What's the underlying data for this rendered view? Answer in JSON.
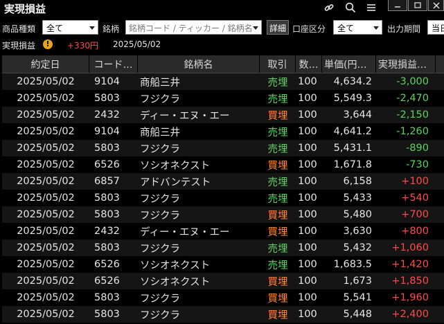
{
  "window": {
    "title": "実現損益"
  },
  "filters": {
    "product_type_label": "商品種類",
    "product_type_value": "全て",
    "issue_label": "銘柄",
    "issue_placeholder": "銘柄コード / ティッカー / 銘柄名",
    "detail_button": "詳細",
    "account_label": "口座区分",
    "account_value": "全て",
    "period_label": "出力期間",
    "period_value": "当日"
  },
  "summary": {
    "label": "実現損益",
    "warn_symbol": "!",
    "value": "+330円",
    "date": "2025/05/02"
  },
  "table": {
    "headers": [
      "約定日",
      "コード…",
      "銘柄名",
      "取引",
      "数…",
      "単価(円…",
      "実現損益…"
    ],
    "rows": [
      {
        "date": "2025/05/02",
        "code": "9104",
        "name": "商船三井",
        "side": "売埋",
        "qty": "100",
        "price": "4,634.2",
        "pl": "-3,000"
      },
      {
        "date": "2025/05/02",
        "code": "5803",
        "name": "フジクラ",
        "side": "売埋",
        "qty": "100",
        "price": "5,549.3",
        "pl": "-2,470"
      },
      {
        "date": "2025/05/02",
        "code": "2432",
        "name": "ディー・エヌ・エー",
        "side": "買埋",
        "qty": "100",
        "price": "3,644",
        "pl": "-2,150"
      },
      {
        "date": "2025/05/02",
        "code": "9104",
        "name": "商船三井",
        "side": "売埋",
        "qty": "100",
        "price": "4,641.2",
        "pl": "-1,260"
      },
      {
        "date": "2025/05/02",
        "code": "5803",
        "name": "フジクラ",
        "side": "売埋",
        "qty": "100",
        "price": "5,431.1",
        "pl": "-890"
      },
      {
        "date": "2025/05/02",
        "code": "6526",
        "name": "ソシオネクスト",
        "side": "買埋",
        "qty": "100",
        "price": "1,671.8",
        "pl": "-730"
      },
      {
        "date": "2025/05/02",
        "code": "6857",
        "name": "アドバンテスト",
        "side": "売埋",
        "qty": "100",
        "price": "6,158",
        "pl": "+100"
      },
      {
        "date": "2025/05/02",
        "code": "5803",
        "name": "フジクラ",
        "side": "売埋",
        "qty": "100",
        "price": "5,433",
        "pl": "+540"
      },
      {
        "date": "2025/05/02",
        "code": "5803",
        "name": "フジクラ",
        "side": "買埋",
        "qty": "100",
        "price": "5,480",
        "pl": "+700"
      },
      {
        "date": "2025/05/02",
        "code": "2432",
        "name": "ディー・エヌ・エー",
        "side": "買埋",
        "qty": "100",
        "price": "3,630",
        "pl": "+800"
      },
      {
        "date": "2025/05/02",
        "code": "5803",
        "name": "フジクラ",
        "side": "売埋",
        "qty": "100",
        "price": "5,432",
        "pl": "+1,060"
      },
      {
        "date": "2025/05/02",
        "code": "6526",
        "name": "ソシオネクスト",
        "side": "売埋",
        "qty": "100",
        "price": "1,683.5",
        "pl": "+1,420"
      },
      {
        "date": "2025/05/02",
        "code": "6526",
        "name": "ソシオネクスト",
        "side": "買埋",
        "qty": "100",
        "price": "1,673",
        "pl": "+1,850"
      },
      {
        "date": "2025/05/02",
        "code": "5803",
        "name": "フジクラ",
        "side": "買埋",
        "qty": "100",
        "price": "5,541",
        "pl": "+1,960"
      },
      {
        "date": "2025/05/02",
        "code": "5803",
        "name": "フジクラ",
        "side": "買埋",
        "qty": "100",
        "price": "5,448",
        "pl": "+2,400"
      }
    ]
  },
  "colors": {
    "background": "#000000",
    "profit": "#ff4c4c",
    "loss": "#5fd35f",
    "sell": "#5fd35f",
    "buy": "#ff8a3c"
  },
  "icons": [
    "link-icon",
    "search-icon",
    "menu-icon",
    "minimize-icon",
    "maximize-icon",
    "close-icon",
    "warning-icon"
  ]
}
